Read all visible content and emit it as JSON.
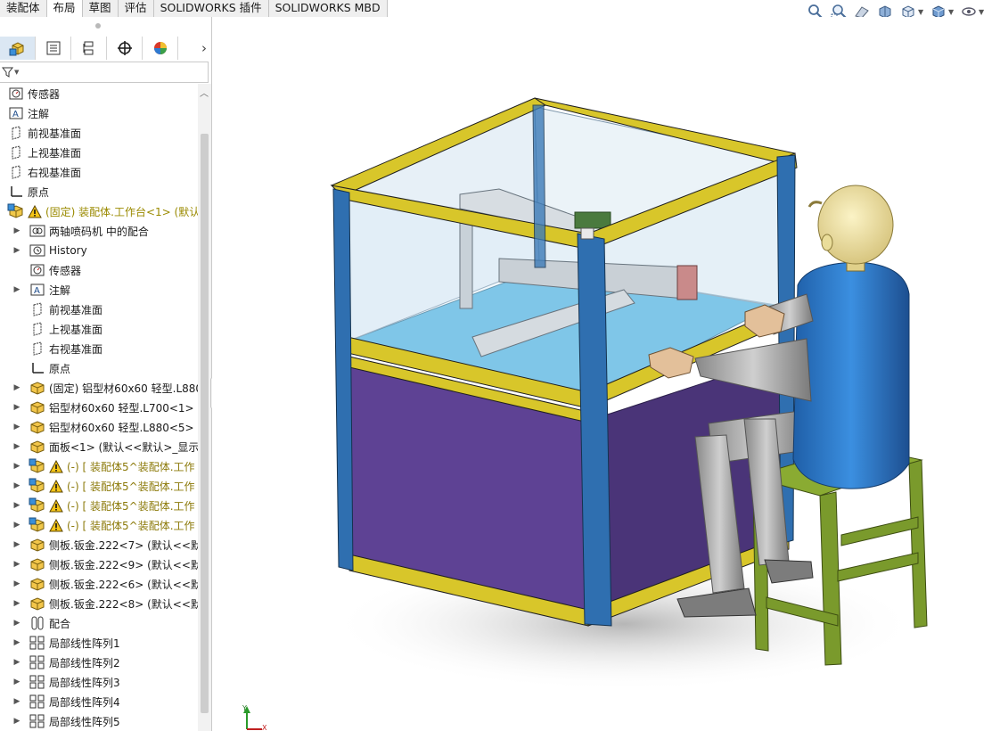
{
  "tabs": [
    {
      "label": "装配体",
      "active": false
    },
    {
      "label": "布局",
      "active": true
    },
    {
      "label": "草图",
      "active": false
    },
    {
      "label": "评估",
      "active": false
    },
    {
      "label": "SOLIDWORKS 插件",
      "active": false
    },
    {
      "label": "SOLIDWORKS MBD",
      "active": false
    }
  ],
  "view_toolbar": {
    "icons": [
      "zoom-to-fit-icon",
      "zoom-area-icon",
      "previous-view-icon",
      "section-view-icon",
      "view-orientation-icon",
      "display-style-icon",
      "hide-show-icon"
    ]
  },
  "panel_tabs": [
    "feature-manager-icon",
    "property-manager-icon",
    "configuration-manager-icon",
    "dimxpert-icon",
    "display-manager-icon"
  ],
  "tree": {
    "items": [
      {
        "label": "传感器",
        "indent": 0,
        "icon": "sensor-icon",
        "expand": false,
        "warn": false,
        "style": ""
      },
      {
        "label": "注解",
        "indent": 0,
        "icon": "annotation-icon",
        "expand": false,
        "warn": false,
        "style": ""
      },
      {
        "label": "前视基准面",
        "indent": 0,
        "icon": "plane-icon",
        "expand": false,
        "warn": false,
        "style": ""
      },
      {
        "label": "上视基准面",
        "indent": 0,
        "icon": "plane-icon",
        "expand": false,
        "warn": false,
        "style": ""
      },
      {
        "label": "右视基准面",
        "indent": 0,
        "icon": "plane-icon",
        "expand": false,
        "warn": false,
        "style": ""
      },
      {
        "label": "原点",
        "indent": 0,
        "icon": "origin-icon",
        "expand": false,
        "warn": false,
        "style": ""
      },
      {
        "label": "(固定) 装配体.工作台<1> (默认",
        "indent": 0,
        "icon": "assembly-icon",
        "expand": false,
        "warn": true,
        "style": "yellow"
      },
      {
        "label": "两轴喷码机 中的配合",
        "indent": 1,
        "icon": "mates-folder-icon",
        "expand": true,
        "warn": false,
        "style": ""
      },
      {
        "label": "History",
        "indent": 1,
        "icon": "history-icon",
        "expand": true,
        "warn": false,
        "style": ""
      },
      {
        "label": "传感器",
        "indent": 1,
        "icon": "sensor-icon",
        "expand": false,
        "warn": false,
        "style": ""
      },
      {
        "label": "注解",
        "indent": 1,
        "icon": "annotation-icon",
        "expand": true,
        "warn": false,
        "style": ""
      },
      {
        "label": "前视基准面",
        "indent": 1,
        "icon": "plane-icon",
        "expand": false,
        "warn": false,
        "style": ""
      },
      {
        "label": "上视基准面",
        "indent": 1,
        "icon": "plane-icon",
        "expand": false,
        "warn": false,
        "style": ""
      },
      {
        "label": "右视基准面",
        "indent": 1,
        "icon": "plane-icon",
        "expand": false,
        "warn": false,
        "style": ""
      },
      {
        "label": "原点",
        "indent": 1,
        "icon": "origin-icon",
        "expand": false,
        "warn": false,
        "style": ""
      },
      {
        "label": "(固定) 铝型材60x60 轻型.L880",
        "indent": 1,
        "icon": "part-icon",
        "expand": true,
        "warn": false,
        "style": ""
      },
      {
        "label": "铝型材60x60 轻型.L700<1> (",
        "indent": 1,
        "icon": "part-icon",
        "expand": true,
        "warn": false,
        "style": ""
      },
      {
        "label": "铝型材60x60 轻型.L880<5> (",
        "indent": 1,
        "icon": "part-icon",
        "expand": true,
        "warn": false,
        "style": ""
      },
      {
        "label": "面板<1> (默认<<默认>_显示:",
        "indent": 1,
        "icon": "part-icon",
        "expand": true,
        "warn": false,
        "style": ""
      },
      {
        "label": "(-) [ 装配体5^装配体.工作",
        "indent": 1,
        "icon": "assembly-icon",
        "expand": true,
        "warn": true,
        "style": "olive"
      },
      {
        "label": "(-) [ 装配体5^装配体.工作",
        "indent": 1,
        "icon": "assembly-icon",
        "expand": true,
        "warn": true,
        "style": "olive"
      },
      {
        "label": "(-) [ 装配体5^装配体.工作",
        "indent": 1,
        "icon": "assembly-icon",
        "expand": true,
        "warn": true,
        "style": "olive"
      },
      {
        "label": "(-) [ 装配体5^装配体.工作",
        "indent": 1,
        "icon": "assembly-icon",
        "expand": true,
        "warn": true,
        "style": "olive"
      },
      {
        "label": "侧板.钣金.222<7> (默认<<默",
        "indent": 1,
        "icon": "part-icon",
        "expand": true,
        "warn": false,
        "style": ""
      },
      {
        "label": "侧板.钣金.222<9> (默认<<默",
        "indent": 1,
        "icon": "part-icon",
        "expand": true,
        "warn": false,
        "style": ""
      },
      {
        "label": "侧板.钣金.222<6> (默认<<默",
        "indent": 1,
        "icon": "part-icon",
        "expand": true,
        "warn": false,
        "style": ""
      },
      {
        "label": "侧板.钣金.222<8> (默认<<默",
        "indent": 1,
        "icon": "part-icon",
        "expand": true,
        "warn": false,
        "style": ""
      },
      {
        "label": "配合",
        "indent": 1,
        "icon": "mates-icon",
        "expand": true,
        "warn": false,
        "style": ""
      },
      {
        "label": "局部线性阵列1",
        "indent": 1,
        "icon": "pattern-icon",
        "expand": true,
        "warn": false,
        "style": ""
      },
      {
        "label": "局部线性阵列2",
        "indent": 1,
        "icon": "pattern-icon",
        "expand": true,
        "warn": false,
        "style": ""
      },
      {
        "label": "局部线性阵列3",
        "indent": 1,
        "icon": "pattern-icon",
        "expand": true,
        "warn": false,
        "style": ""
      },
      {
        "label": "局部线性阵列4",
        "indent": 1,
        "icon": "pattern-icon",
        "expand": true,
        "warn": false,
        "style": ""
      },
      {
        "label": "局部线性阵列5",
        "indent": 1,
        "icon": "pattern-icon",
        "expand": true,
        "warn": false,
        "style": ""
      }
    ]
  },
  "triad": {
    "y_label": "Y",
    "x_label": "X"
  },
  "colors": {
    "frame_blue": "#2f6fb0",
    "frame_yellow": "#d8c62a",
    "panel_purple": "#5b3f8f",
    "table_blue": "#4fb3e0",
    "stool_green": "#7a9a2c",
    "person_blue": "#2a78c8",
    "person_gray": "#a7a7a7",
    "head_yellow": "#eadd9a",
    "hand_tan": "#e3c09a"
  }
}
